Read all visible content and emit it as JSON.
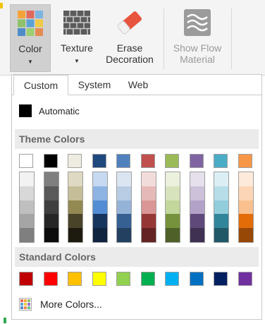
{
  "ribbon": {
    "color_label": "Color",
    "texture_label": "Texture",
    "erase_label_line1": "Erase",
    "erase_label_line2": "Decoration",
    "flow_label_line1": "Show Flow",
    "flow_label_line2": "Material",
    "dropdown_glyph": "▼"
  },
  "tabs": [
    "Custom",
    "System",
    "Web"
  ],
  "automatic_label": "Automatic",
  "theme_header": "Theme Colors",
  "standard_header": "Standard Colors",
  "more_colors_label": "More Colors...",
  "icons": {
    "color": "color-palette-icon",
    "texture": "brick-texture-icon",
    "erase": "eraser-icon",
    "flow": "flow-waves-icon",
    "more": "color-grid-icon"
  },
  "theme_colors": [
    {
      "base": "#ffffff",
      "shades": [
        "#f2f2f2",
        "#d8d8d8",
        "#bfbfbf",
        "#a5a5a5",
        "#7f7f7f"
      ]
    },
    {
      "base": "#000000",
      "shades": [
        "#7f7f7f",
        "#595959",
        "#3f3f3f",
        "#262626",
        "#0c0c0c"
      ]
    },
    {
      "base": "#eeece1",
      "shades": [
        "#ddd9c3",
        "#c4bd97",
        "#938953",
        "#494429",
        "#1d1b10"
      ]
    },
    {
      "base": "#1f497d",
      "shades": [
        "#c6d9f0",
        "#8db3e2",
        "#548dd4",
        "#17365d",
        "#0f243e"
      ]
    },
    {
      "base": "#4f81bd",
      "shades": [
        "#dbe5f1",
        "#b8cce4",
        "#95b3d7",
        "#366092",
        "#244061"
      ]
    },
    {
      "base": "#c0504d",
      "shades": [
        "#f2dcdb",
        "#e5b9b7",
        "#d99694",
        "#953734",
        "#632423"
      ]
    },
    {
      "base": "#9bbb59",
      "shades": [
        "#ebf1dd",
        "#d7e3bc",
        "#c3d69b",
        "#76923c",
        "#4f6128"
      ]
    },
    {
      "base": "#8064a2",
      "shades": [
        "#e5e0ec",
        "#ccc1d9",
        "#b2a2c7",
        "#5f497a",
        "#3f3151"
      ]
    },
    {
      "base": "#4bacc6",
      "shades": [
        "#dbeef3",
        "#b7dde8",
        "#92cddc",
        "#31859b",
        "#205867"
      ]
    },
    {
      "base": "#f79646",
      "shades": [
        "#fdeada",
        "#fbd5b5",
        "#fac08f",
        "#e36c09",
        "#974806"
      ]
    }
  ],
  "standard_colors": [
    "#c00000",
    "#ff0000",
    "#ffc000",
    "#ffff00",
    "#92d050",
    "#00b050",
    "#00b0f0",
    "#0070c0",
    "#002060",
    "#7030a0"
  ]
}
